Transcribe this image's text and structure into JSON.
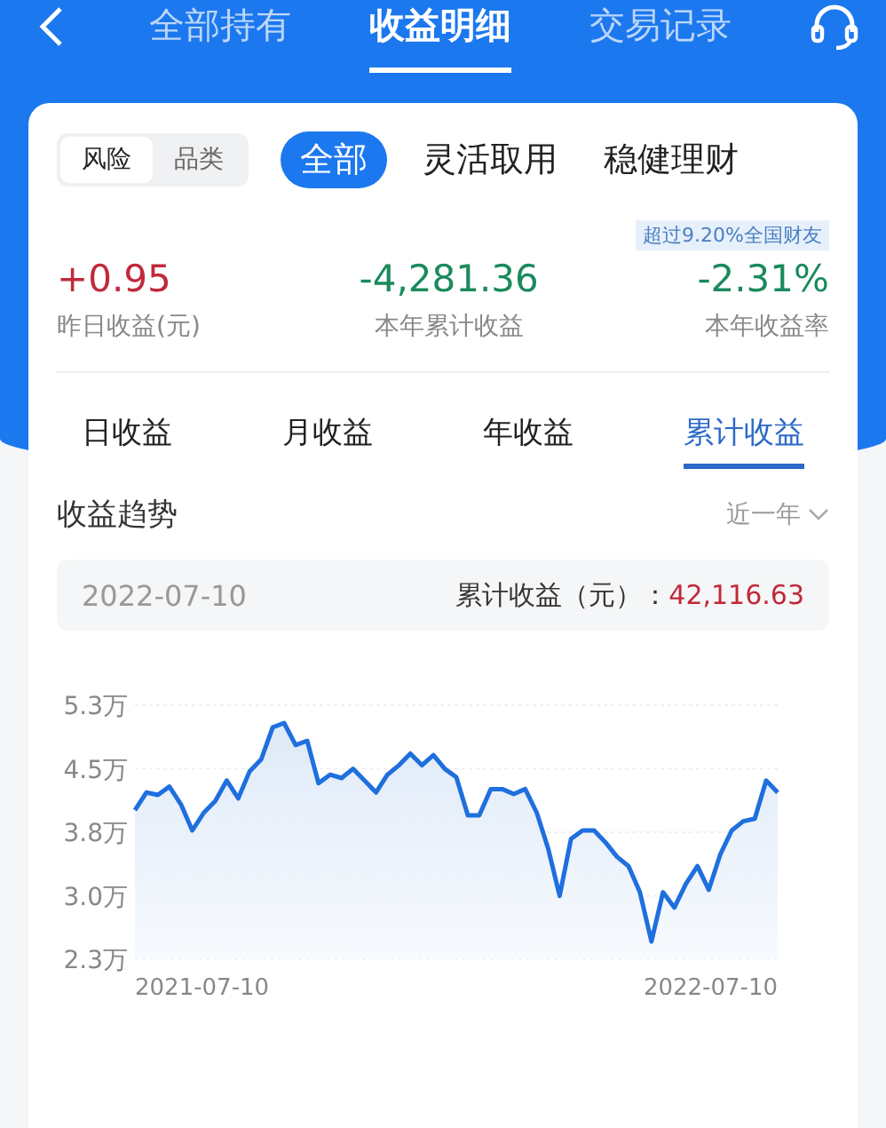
{
  "nav": {
    "tabs": [
      {
        "label": "全部持有",
        "selected": false
      },
      {
        "label": "收益明细",
        "selected": true
      },
      {
        "label": "交易记录",
        "selected": false
      }
    ]
  },
  "filters": {
    "segments": [
      {
        "label": "风险",
        "selected": true
      },
      {
        "label": "品类",
        "selected": false
      }
    ],
    "categories": [
      {
        "label": "全部",
        "selected": true
      },
      {
        "label": "灵活取用",
        "selected": false
      },
      {
        "label": "稳健理财",
        "selected": false
      }
    ]
  },
  "rank_badge": "超过9.20%全国财友",
  "stats": [
    {
      "value": "+0.95",
      "label": "昨日收益(元)",
      "color": "#c0293a"
    },
    {
      "value": "-4,281.36",
      "label": "本年累计收益",
      "color": "#1a8a5c"
    },
    {
      "value": "-2.31%",
      "label": "本年收益率",
      "color": "#1a8a5c"
    }
  ],
  "periods": [
    {
      "label": "日收益",
      "selected": false
    },
    {
      "label": "月收益",
      "selected": false
    },
    {
      "label": "年收益",
      "selected": false
    },
    {
      "label": "累计收益",
      "selected": true
    }
  ],
  "trend": {
    "title": "收益趋势",
    "range": "近一年",
    "date": "2022-07-10",
    "total_label": "累计收益（元）：",
    "total_value": "42,116.63",
    "x_start": "2021-07-10",
    "x_end": "2022-07-10",
    "chart_data": {
      "type": "area",
      "ylim": [
        2.3,
        5.3
      ],
      "grid": true,
      "yticks": [
        {
          "value": 2.3,
          "label": "2.3万"
        },
        {
          "value": 3.05,
          "label": "3.0万"
        },
        {
          "value": 3.8,
          "label": "3.8万"
        },
        {
          "value": 4.55,
          "label": "4.5万"
        },
        {
          "value": 5.3,
          "label": "5.3万"
        }
      ],
      "series": [
        {
          "color": "#1f6fde",
          "values": [
            4.06,
            4.27,
            4.24,
            4.34,
            4.13,
            3.82,
            4.03,
            4.17,
            4.41,
            4.2,
            4.52,
            4.66,
            5.04,
            5.09,
            4.83,
            4.88,
            4.38,
            4.48,
            4.44,
            4.55,
            4.41,
            4.27,
            4.48,
            4.59,
            4.73,
            4.59,
            4.71,
            4.55,
            4.45,
            4.0,
            4.0,
            4.31,
            4.31,
            4.25,
            4.31,
            4.03,
            3.61,
            3.05,
            3.72,
            3.82,
            3.82,
            3.68,
            3.51,
            3.4,
            3.09,
            2.51,
            3.09,
            2.91,
            3.19,
            3.4,
            3.12,
            3.54,
            3.82,
            3.93,
            3.96,
            4.41,
            4.27
          ]
        }
      ]
    }
  }
}
